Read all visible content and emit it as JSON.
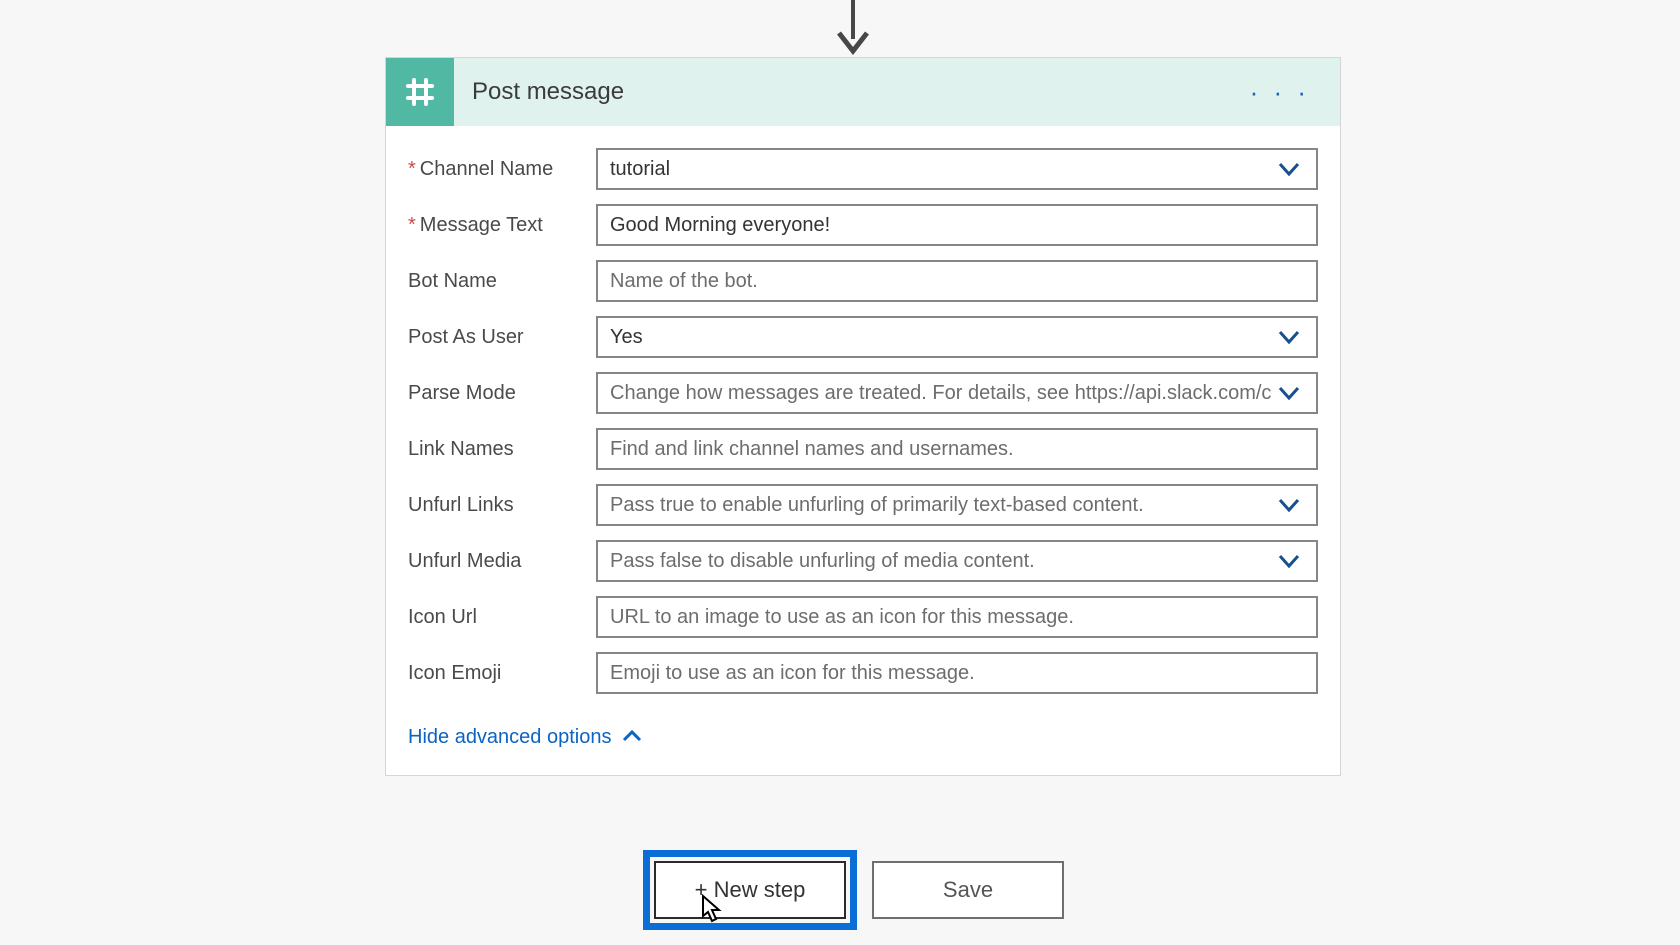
{
  "card": {
    "title": "Post message",
    "fields": {
      "channel_name": {
        "label": "Channel Name",
        "value": "tutorial"
      },
      "message_text": {
        "label": "Message Text",
        "value": "Good Morning everyone!"
      },
      "bot_name": {
        "label": "Bot Name",
        "placeholder": "Name of the bot."
      },
      "post_as_user": {
        "label": "Post As User",
        "value": "Yes"
      },
      "parse_mode": {
        "label": "Parse Mode",
        "placeholder": "Change how messages are treated. For details, see https://api.slack.com/c"
      },
      "link_names": {
        "label": "Link Names",
        "placeholder": "Find and link channel names and usernames."
      },
      "unfurl_links": {
        "label": "Unfurl Links",
        "placeholder": "Pass true to enable unfurling of primarily text-based content."
      },
      "unfurl_media": {
        "label": "Unfurl Media",
        "placeholder": "Pass false to disable unfurling of media content."
      },
      "icon_url": {
        "label": "Icon Url",
        "placeholder": "URL to an image to use as an icon for this message."
      },
      "icon_emoji": {
        "label": "Icon Emoji",
        "placeholder": "Emoji to use as an icon for this message."
      }
    },
    "hide_advanced_label": "Hide advanced options"
  },
  "buttons": {
    "new_step": "+ New step",
    "save": "Save"
  }
}
